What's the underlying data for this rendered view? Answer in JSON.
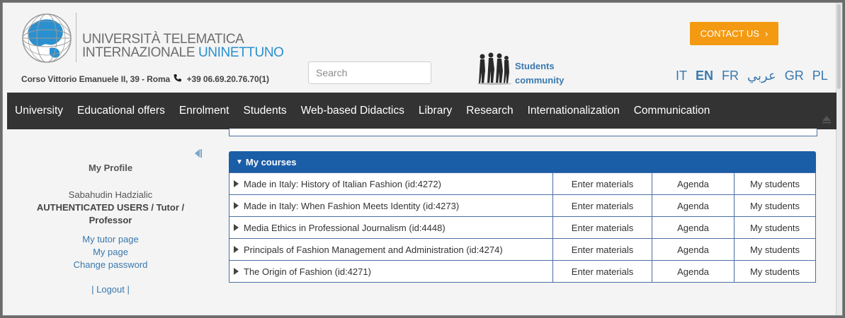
{
  "header": {
    "logo_line1": "UNIVERSITÀ TELEMATICA",
    "logo_line2a": "INTERNAZIONALE ",
    "logo_line2b": "UNINETTUNO",
    "address": "Corso Vittorio Emanuele II, 39 - Roma",
    "phone": "+39 06.69.20.76.70(1)",
    "search_placeholder": "Search",
    "community_line1": "Students",
    "community_line2": "community",
    "contact_label": "CONTACT US",
    "contact_chevron": "›",
    "languages": [
      "IT",
      "EN",
      "FR",
      "عربي",
      "GR",
      "PL"
    ],
    "active_language": "EN"
  },
  "nav": {
    "items": [
      "University",
      "Educational offers",
      "Enrolment",
      "Students",
      "Web-based Didactics",
      "Library",
      "Research",
      "Internationalization",
      "Communication"
    ]
  },
  "sidebar": {
    "title": "My Profile",
    "user_name": "Sabahudin Hadzialic",
    "role": "AUTHENTICATED USERS / Tutor / Professor",
    "links": [
      "My tutor page",
      "My page",
      "Change password"
    ],
    "logout": "| Logout |"
  },
  "courses": {
    "header": "My courses",
    "rows": [
      {
        "name": "Made in Italy: History of Italian Fashion (id:4272)",
        "enter": "Enter materials",
        "agenda": "Agenda",
        "students": "My students"
      },
      {
        "name": "Made in Italy: When Fashion Meets Identity (id:4273)",
        "enter": "Enter materials",
        "agenda": "Agenda",
        "students": "My students"
      },
      {
        "name": "Media Ethics in Professional Journalism (id:4448)",
        "enter": "Enter materials",
        "agenda": "Agenda",
        "students": "My students"
      },
      {
        "name": "Principals of Fashion Management and Administration (id:4274)",
        "enter": "Enter materials",
        "agenda": "Agenda",
        "students": "My students"
      },
      {
        "name": "The Origin of Fashion (id:4271)",
        "enter": "Enter materials",
        "agenda": "Agenda",
        "students": "My students"
      }
    ]
  },
  "colors": {
    "nav_bg": "#333333",
    "accent_blue": "#1b5ea8",
    "contact_orange": "#f39a12",
    "link_blue": "#3a78ad"
  },
  "icons": [
    "globe-logo-icon",
    "phone-icon",
    "students-community-icon",
    "collapse-up-icon",
    "sidebar-collapse-icon",
    "caret-down-icon",
    "caret-right-icon"
  ]
}
